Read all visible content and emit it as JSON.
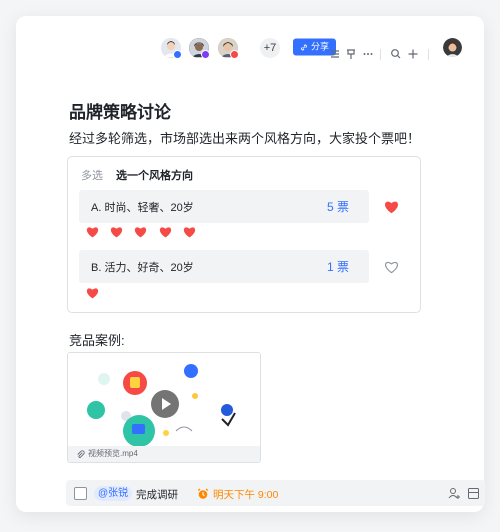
{
  "colors": {
    "accent": "#3370ff",
    "heart": "#f54a45",
    "due": "#ff8800"
  },
  "toolbar": {
    "collaborators": [
      {
        "name": "avatar-1",
        "bg": "#c9d4e5",
        "dot": "#3370ff"
      },
      {
        "name": "avatar-2",
        "bg": "#5a4a43",
        "dot": "#7f3bf5"
      },
      {
        "name": "avatar-3",
        "bg": "#b6a99a",
        "dot": "#f54a45"
      }
    ],
    "more_count": "+7",
    "share_label": "分享",
    "icons": [
      "outline-icon",
      "pin-icon",
      "more-icon",
      "search-icon",
      "add-icon"
    ],
    "user_avatar": "user-avatar"
  },
  "doc": {
    "title": "品牌策略讨论",
    "description": "经过多轮筛选，市场部选出来两个风格方向，大家投个票吧！"
  },
  "poll": {
    "tag": "多选",
    "question": "选一个风格方向",
    "options": [
      {
        "label": "A. 时尚、轻奢、20岁",
        "count": "5 票",
        "voted": true,
        "voter_hearts": 5
      },
      {
        "label": "B. 活力、好奇、20岁",
        "count": "1 票",
        "voted": false,
        "voter_hearts": 1
      }
    ]
  },
  "competitors": {
    "title": "竞品案例:",
    "video": {
      "caption": "视频预览.mp4",
      "play_icon": "play-icon"
    }
  },
  "task": {
    "mention": "@张锐",
    "text": "完成调研",
    "due": "明天下午  9:00",
    "icons": [
      "alarm-icon",
      "add-member-icon",
      "task-detail-icon"
    ]
  }
}
